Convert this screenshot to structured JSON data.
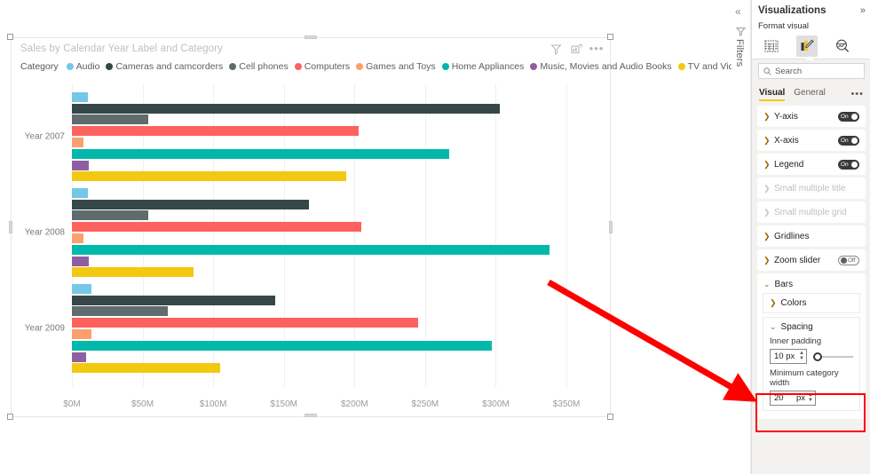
{
  "canvas": {
    "visual": {
      "title": "Sales by Calendar Year Label and Category",
      "tools": {
        "filter_icon": "filter-icon",
        "focus_icon": "focus-mode-icon",
        "more_label": "•••"
      },
      "legend": {
        "title": "Category",
        "items": [
          {
            "label": "Audio",
            "color": "#73c8e8"
          },
          {
            "label": "Cameras and camcorders",
            "color": "#374649"
          },
          {
            "label": "Cell phones",
            "color": "#5f6b6d"
          },
          {
            "label": "Computers",
            "color": "#fd625e"
          },
          {
            "label": "Games and Toys",
            "color": "#ff9e6d"
          },
          {
            "label": "Home Appliances",
            "color": "#01b8aa"
          },
          {
            "label": "Music, Movies and Audio Books",
            "color": "#8e5ea2"
          },
          {
            "label": "TV and Video",
            "color": "#f2c811"
          }
        ]
      }
    }
  },
  "chart_data": {
    "type": "bar",
    "orientation": "horizontal",
    "title": "Sales by Calendar Year Label and Category",
    "xlabel": "",
    "ylabel": "",
    "xlim": [
      0,
      350
    ],
    "units": "millions USD",
    "xtick_labels": [
      "$0M",
      "$50M",
      "$100M",
      "$150M",
      "$200M",
      "$250M",
      "$300M",
      "$350M"
    ],
    "xticks": [
      0,
      50,
      100,
      150,
      200,
      250,
      300,
      350
    ],
    "grid": true,
    "legend_position": "top",
    "categories": [
      "Year 2007",
      "Year 2008",
      "Year 2009"
    ],
    "series": [
      {
        "name": "Audio",
        "color": "#73c8e8",
        "values": [
          11,
          11,
          14
        ]
      },
      {
        "name": "Cameras and camcorders",
        "color": "#374649",
        "values": [
          303,
          168,
          144
        ]
      },
      {
        "name": "Cell phones",
        "color": "#5f6b6d",
        "values": [
          54,
          54,
          68
        ]
      },
      {
        "name": "Computers",
        "color": "#fd625e",
        "values": [
          203,
          205,
          245
        ]
      },
      {
        "name": "Games and Toys",
        "color": "#ff9e6d",
        "values": [
          8,
          8,
          14
        ]
      },
      {
        "name": "Home Appliances",
        "color": "#01b8aa",
        "values": [
          267,
          338,
          297
        ]
      },
      {
        "name": "Music, Movies and Audio Books",
        "color": "#8e5ea2",
        "values": [
          12,
          12,
          10
        ]
      },
      {
        "name": "TV and Video",
        "color": "#f2c811",
        "values": [
          194,
          86,
          105
        ]
      }
    ]
  },
  "filters_rail": {
    "collapse_label": "«",
    "filter_icon": "filter-icon",
    "label": "Filters"
  },
  "viz_pane": {
    "header": {
      "title": "Visualizations",
      "collapse": "»"
    },
    "format_visual_label": "Format visual",
    "icon_tabs": [
      {
        "name": "build-visual-icon",
        "selected": false
      },
      {
        "name": "format-visual-icon",
        "selected": true
      },
      {
        "name": "analytics-icon",
        "selected": false
      }
    ],
    "search": {
      "placeholder": "Search",
      "icon": "search-icon"
    },
    "tabs": [
      {
        "label": "Visual",
        "active": true
      },
      {
        "label": "General",
        "active": false
      }
    ],
    "tabs_more": "•••",
    "cards": [
      {
        "name": "Y-axis",
        "toggle": "On",
        "state": "on",
        "enabled": true
      },
      {
        "name": "X-axis",
        "toggle": "On",
        "state": "on",
        "enabled": true
      },
      {
        "name": "Legend",
        "toggle": "On",
        "state": "on",
        "enabled": true
      },
      {
        "name": "Small multiple title",
        "toggle": null,
        "state": null,
        "enabled": false
      },
      {
        "name": "Small multiple grid",
        "toggle": null,
        "state": null,
        "enabled": false
      },
      {
        "name": "Gridlines",
        "toggle": null,
        "state": null,
        "enabled": true
      },
      {
        "name": "Zoom slider",
        "toggle": "Off",
        "state": "off",
        "enabled": true
      }
    ],
    "bars_group": {
      "name": "Bars",
      "colors_card": {
        "name": "Colors"
      },
      "spacing_card": {
        "name": "Spacing",
        "inner_padding": {
          "label": "Inner padding",
          "value": "10 px",
          "slider_percent": 12
        },
        "minimum_category_width": {
          "label": "Minimum category width",
          "value": "20",
          "unit": "px"
        }
      }
    }
  },
  "annotation": {
    "arrow_color": "#ff0000",
    "highlight_color": "#ff0000"
  }
}
